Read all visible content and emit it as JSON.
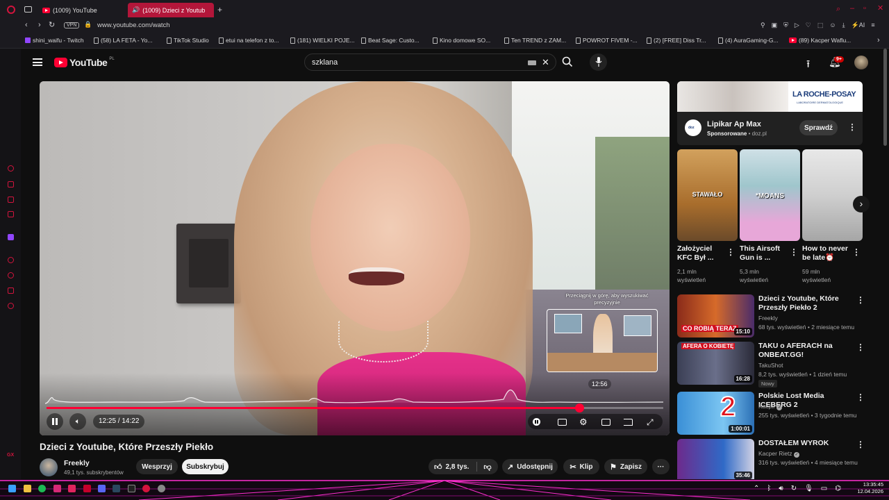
{
  "browser": {
    "tabs": [
      {
        "label": "(1009) YouTube"
      },
      {
        "label": "(1009) Dzieci z Youtub"
      }
    ],
    "new_tab": "+",
    "vpn": "VPN",
    "url": "www.youtube.com/watch",
    "ai_label": "AI",
    "bookmarks": [
      "shini_waifu - Twitch",
      "(58) LA FETA - Yo...",
      "TikTok Studio",
      "etui na telefon z to...",
      "(181) WIELKI POJE...",
      "Beat Sage: Custo...",
      "Kino domowe SO...",
      "Ten TREND z ZAM...",
      "POWROT FIVEM -...",
      "(2) [FREE] Diss Tr...",
      "(4) AuraGaming-G...",
      "(89) Kacper Waflu..."
    ]
  },
  "youtube": {
    "logo_text": "YouTube",
    "region": "PL",
    "search_value": "szklana",
    "notif_count": "9+",
    "player": {
      "seek_hint": "Przeciągnij w górę, aby wyszukiwać precyzyjnie",
      "preview_time": "12:56",
      "time": "12:25 / 14:22",
      "progress": 0.864
    },
    "video_title": "Dzieci z Youtube, Które Przeszły Piekło",
    "channel": {
      "name": "Freekly",
      "subs": "49,1 tys. subskrybentów"
    },
    "actions": {
      "support": "Wesprzyj",
      "subscribe": "Subskrybuj",
      "likes": "2,8 tys.",
      "share": "Udostępnij",
      "clip": "Klip",
      "save": "Zapisz"
    },
    "ad": {
      "brand": "LA ROCHE-POSAY",
      "brand_sub": "LABORATOIRE DERMATOLOGIQUE",
      "title": "Lipikar Ap Max",
      "sponsored": "Sponsorowane",
      "domain": "doz.pl",
      "cta": "Sprawdź"
    },
    "shorts": [
      {
        "title": "Założyciel KFC Był ...",
        "views": "2,1 mln wyświetleń",
        "overlay": "STAWAŁO"
      },
      {
        "title": "This Airsoft Gun is ...",
        "views": "5,3 mln wyświetleń",
        "overlay": "*MOANS"
      },
      {
        "title": "How to never be late⏰",
        "views": "59 mln wyświetleń",
        "overlay": ""
      }
    ],
    "related": [
      {
        "title": "Dzieci z Youtube, Które Przeszły Piekło 2",
        "channel": "Freekly",
        "meta": "68 tys. wyświetleń • 2 miesiące temu",
        "duration": "15:10",
        "thumb_text": "CO ROBIĄ TERAZ",
        "badge": "",
        "verified": false,
        "thumb": "#8a2b1a"
      },
      {
        "title": "TAKU o AFERACH na ONBEAT.GG!",
        "channel": "TakuShot",
        "meta": "8,2 tys. wyświetleń • 1 dzień temu",
        "duration": "16:28",
        "thumb_text": "AFERA O KOBIETĘ",
        "badge": "Nowy",
        "verified": false,
        "thumb": "#3b3f55"
      },
      {
        "title": "Polskie Lost Media ICEBERG 2",
        "channel": "Kacpir",
        "meta": "255 tys. wyświetleń • 3 tygodnie temu",
        "duration": "1:00:01",
        "thumb_text": "2",
        "badge": "",
        "verified": true,
        "thumb": "#3a8fd6"
      },
      {
        "title": "DOSTAŁEM WYROK",
        "channel": "Kacper Rietz",
        "meta": "316 tys. wyświetleń • 4 miesiące temu",
        "duration": "35:46",
        "thumb_text": "",
        "badge": "",
        "verified": true,
        "thumb": "#6d2a8c"
      }
    ]
  },
  "taskbar": {
    "time": "13:35:45",
    "date": "12.04.2026",
    "gx": "GX"
  },
  "colors": {
    "accent": "#ff0033",
    "browser_accent": "#d3143d",
    "bg": "#0f0f0f"
  }
}
